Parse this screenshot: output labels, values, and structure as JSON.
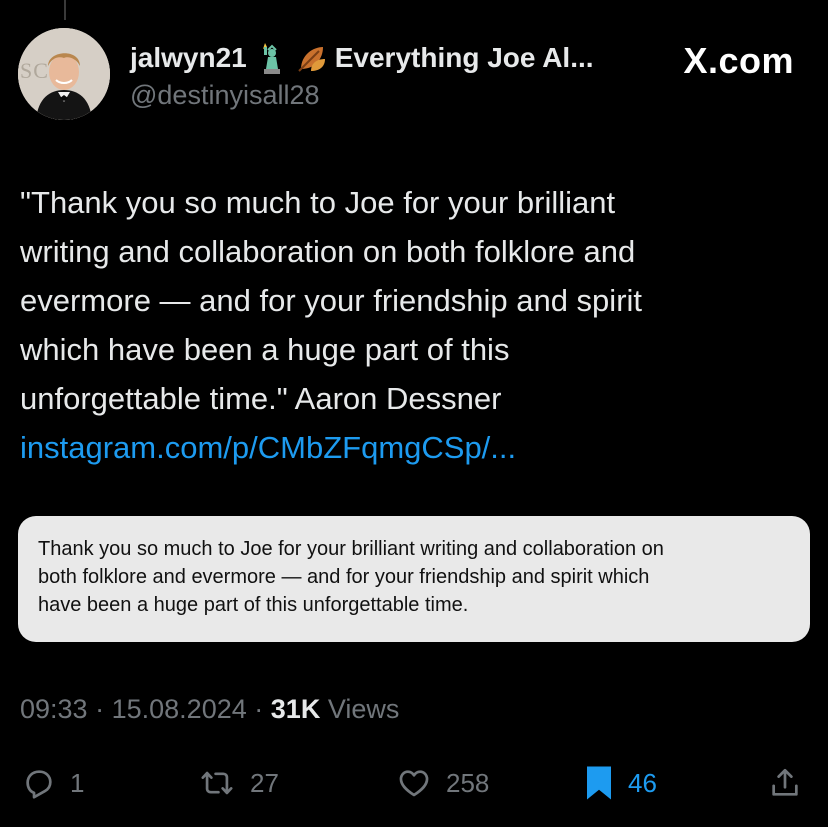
{
  "header": {
    "display_name": "jalwyn21",
    "emoji_1": "statue-of-liberty-emoji",
    "emoji_2": "fallen-leaf-emoji",
    "community": "Everything Joe Al...",
    "handle": "@destinyisall28",
    "site_label": "X.com",
    "avatar_letters": "SC"
  },
  "tweet": {
    "lines": [
      "\"Thank you so much to Joe for your brilliant",
      "writing and collaboration on both folklore and",
      "evermore — and for your friendship and spirit",
      "which have been a huge part of this",
      "unforgettable time.\" Aaron Dessner"
    ],
    "link": "instagram.com/p/CMbZFqmgCSp/..."
  },
  "quote_card": {
    "lines": [
      "Thank you so much to Joe for your brilliant writing and collaboration on",
      "both folklore and evermore — and for your friendship and spirit which",
      "have been a huge part of this unforgettable time."
    ]
  },
  "meta": {
    "time": "09:33",
    "separator": "·",
    "date": "15.08.2024",
    "views_count": "31K",
    "views_label": "Views"
  },
  "actions": {
    "replies": "1",
    "reposts": "27",
    "likes": "258",
    "bookmarks": "46"
  },
  "colors": {
    "background": "#000000",
    "text": "#e7e9ea",
    "muted": "#71767b",
    "accent": "#1d9bf0",
    "card": "#e9e9e9"
  }
}
